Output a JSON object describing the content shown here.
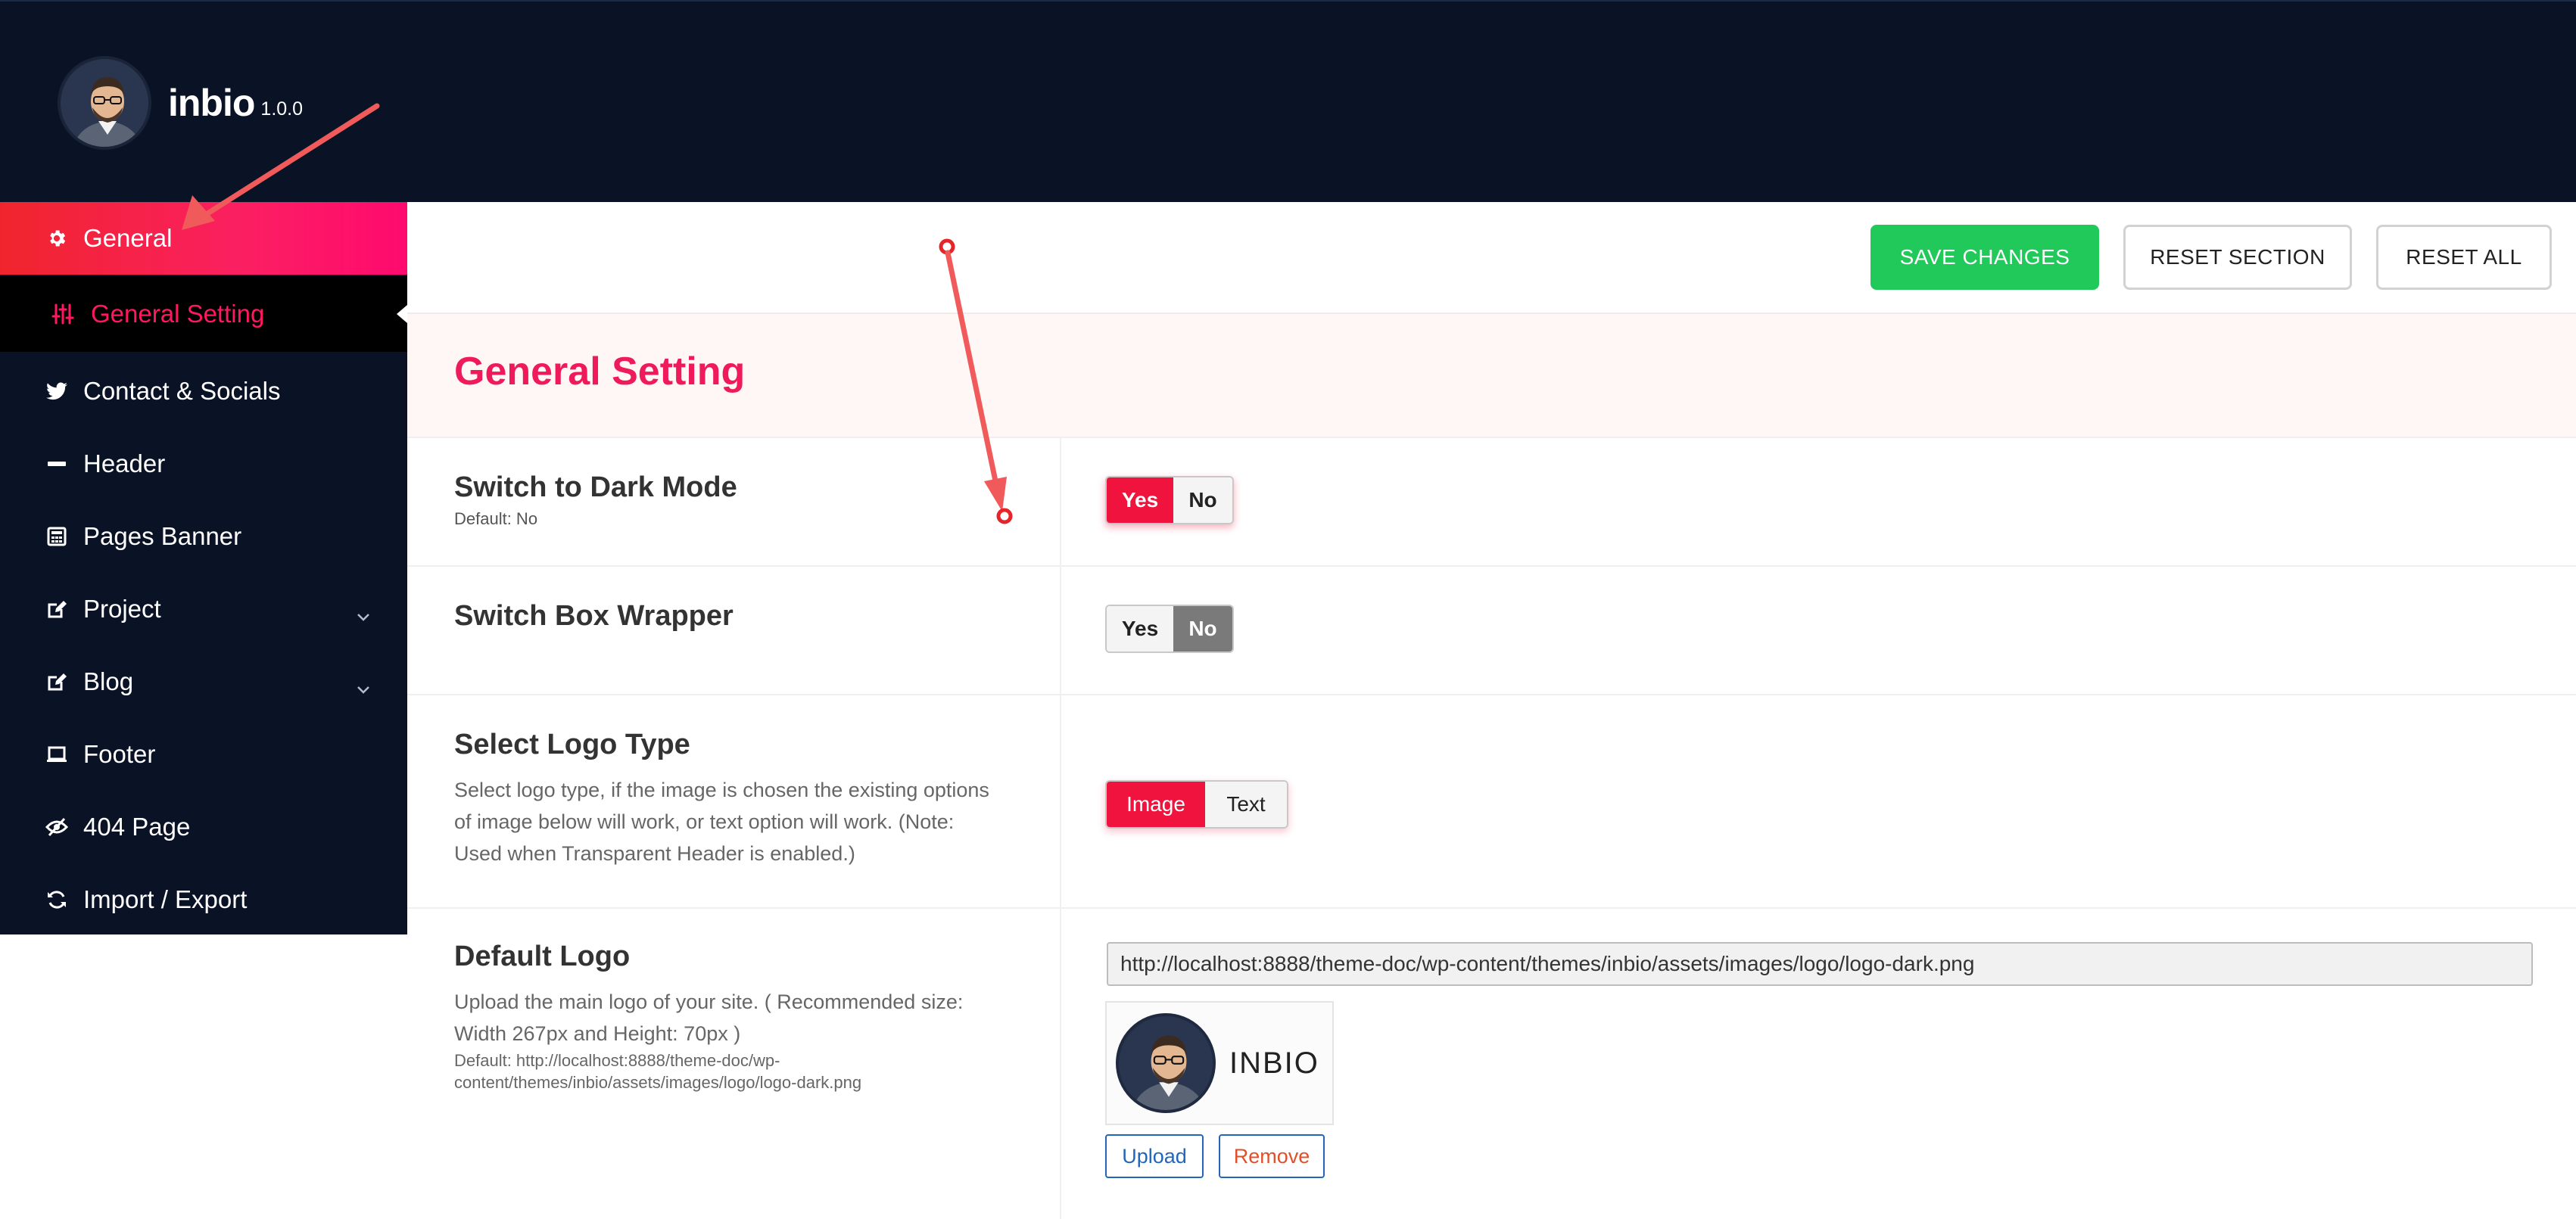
{
  "brand": {
    "name": "inbio",
    "version": "1.0.0"
  },
  "sidebar": {
    "items": [
      {
        "label": "General",
        "icon": "gear-icon",
        "active": true
      },
      {
        "label": "Contact & Socials",
        "icon": "twitter-icon"
      },
      {
        "label": "Header",
        "icon": "minus-icon"
      },
      {
        "label": "Pages Banner",
        "icon": "calculator-icon"
      },
      {
        "label": "Project",
        "icon": "edit-icon",
        "has_children": true
      },
      {
        "label": "Blog",
        "icon": "edit-icon",
        "has_children": true
      },
      {
        "label": "Footer",
        "icon": "laptop-icon"
      },
      {
        "label": "404 Page",
        "icon": "eye-slash-icon"
      },
      {
        "label": "Import / Export",
        "icon": "refresh-icon"
      }
    ],
    "sub_item": {
      "label": "General Setting",
      "icon": "sliders-icon"
    }
  },
  "toolbar": {
    "save_label": "SAVE CHANGES",
    "reset_section_label": "RESET SECTION",
    "reset_all_label": "RESET ALL"
  },
  "section": {
    "title": "General Setting"
  },
  "settings": {
    "dark_mode": {
      "title": "Switch to Dark Mode",
      "default": "Default: No",
      "options": [
        "Yes",
        "No"
      ],
      "selected": "Yes"
    },
    "box_wrapper": {
      "title": "Switch Box Wrapper",
      "options": [
        "Yes",
        "No"
      ],
      "selected": "No"
    },
    "logo_type": {
      "title": "Select Logo Type",
      "description": "Select logo type, if the image is chosen the existing options of image below will work, or text option will work. (Note: Used when Transparent Header is enabled.)",
      "options": [
        "Image",
        "Text"
      ],
      "selected": "Image"
    },
    "default_logo": {
      "title": "Default Logo",
      "description": "Upload the main logo of your site. ( Recommended size: Width 267px and Height: 70px )",
      "default": "Default: http://localhost:8888/theme-doc/wp-content/themes/inbio/assets/images/logo/logo-dark.png",
      "url": "http://localhost:8888/theme-doc/wp-content/themes/inbio/assets/images/logo/logo-dark.png",
      "preview_text": "INBIO",
      "upload_label": "Upload",
      "remove_label": "Remove"
    }
  },
  "colors": {
    "navy": "#0a1226",
    "accent": "#f0133e",
    "section_title": "#ef1a5a",
    "save": "#21c85a",
    "annotation": "#f05050"
  }
}
